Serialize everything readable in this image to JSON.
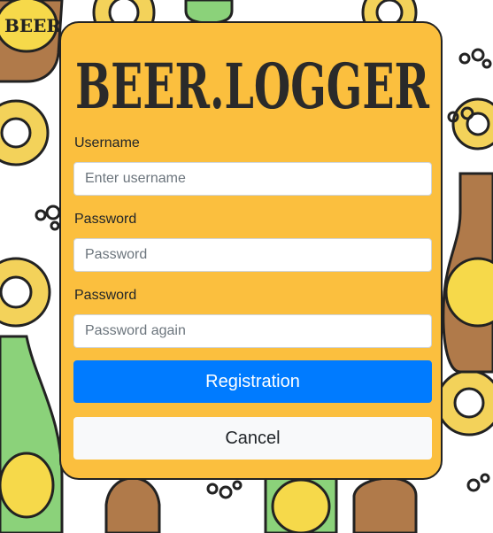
{
  "brand": {
    "logo_text": "BEER.LOGGER",
    "logo_color": "#2a2a2a",
    "panel_color": "#fbbf3e"
  },
  "form": {
    "username_label": "Username",
    "username_placeholder": "Enter username",
    "password_label": "Password",
    "password_placeholder": "Password",
    "password_confirm_label": "Password",
    "password_confirm_placeholder": "Password again",
    "register_label": "Registration",
    "cancel_label": "Cancel"
  },
  "background": {
    "pattern": "beer bottles and pretzels illustration",
    "bottle_label_text": "BEER"
  }
}
